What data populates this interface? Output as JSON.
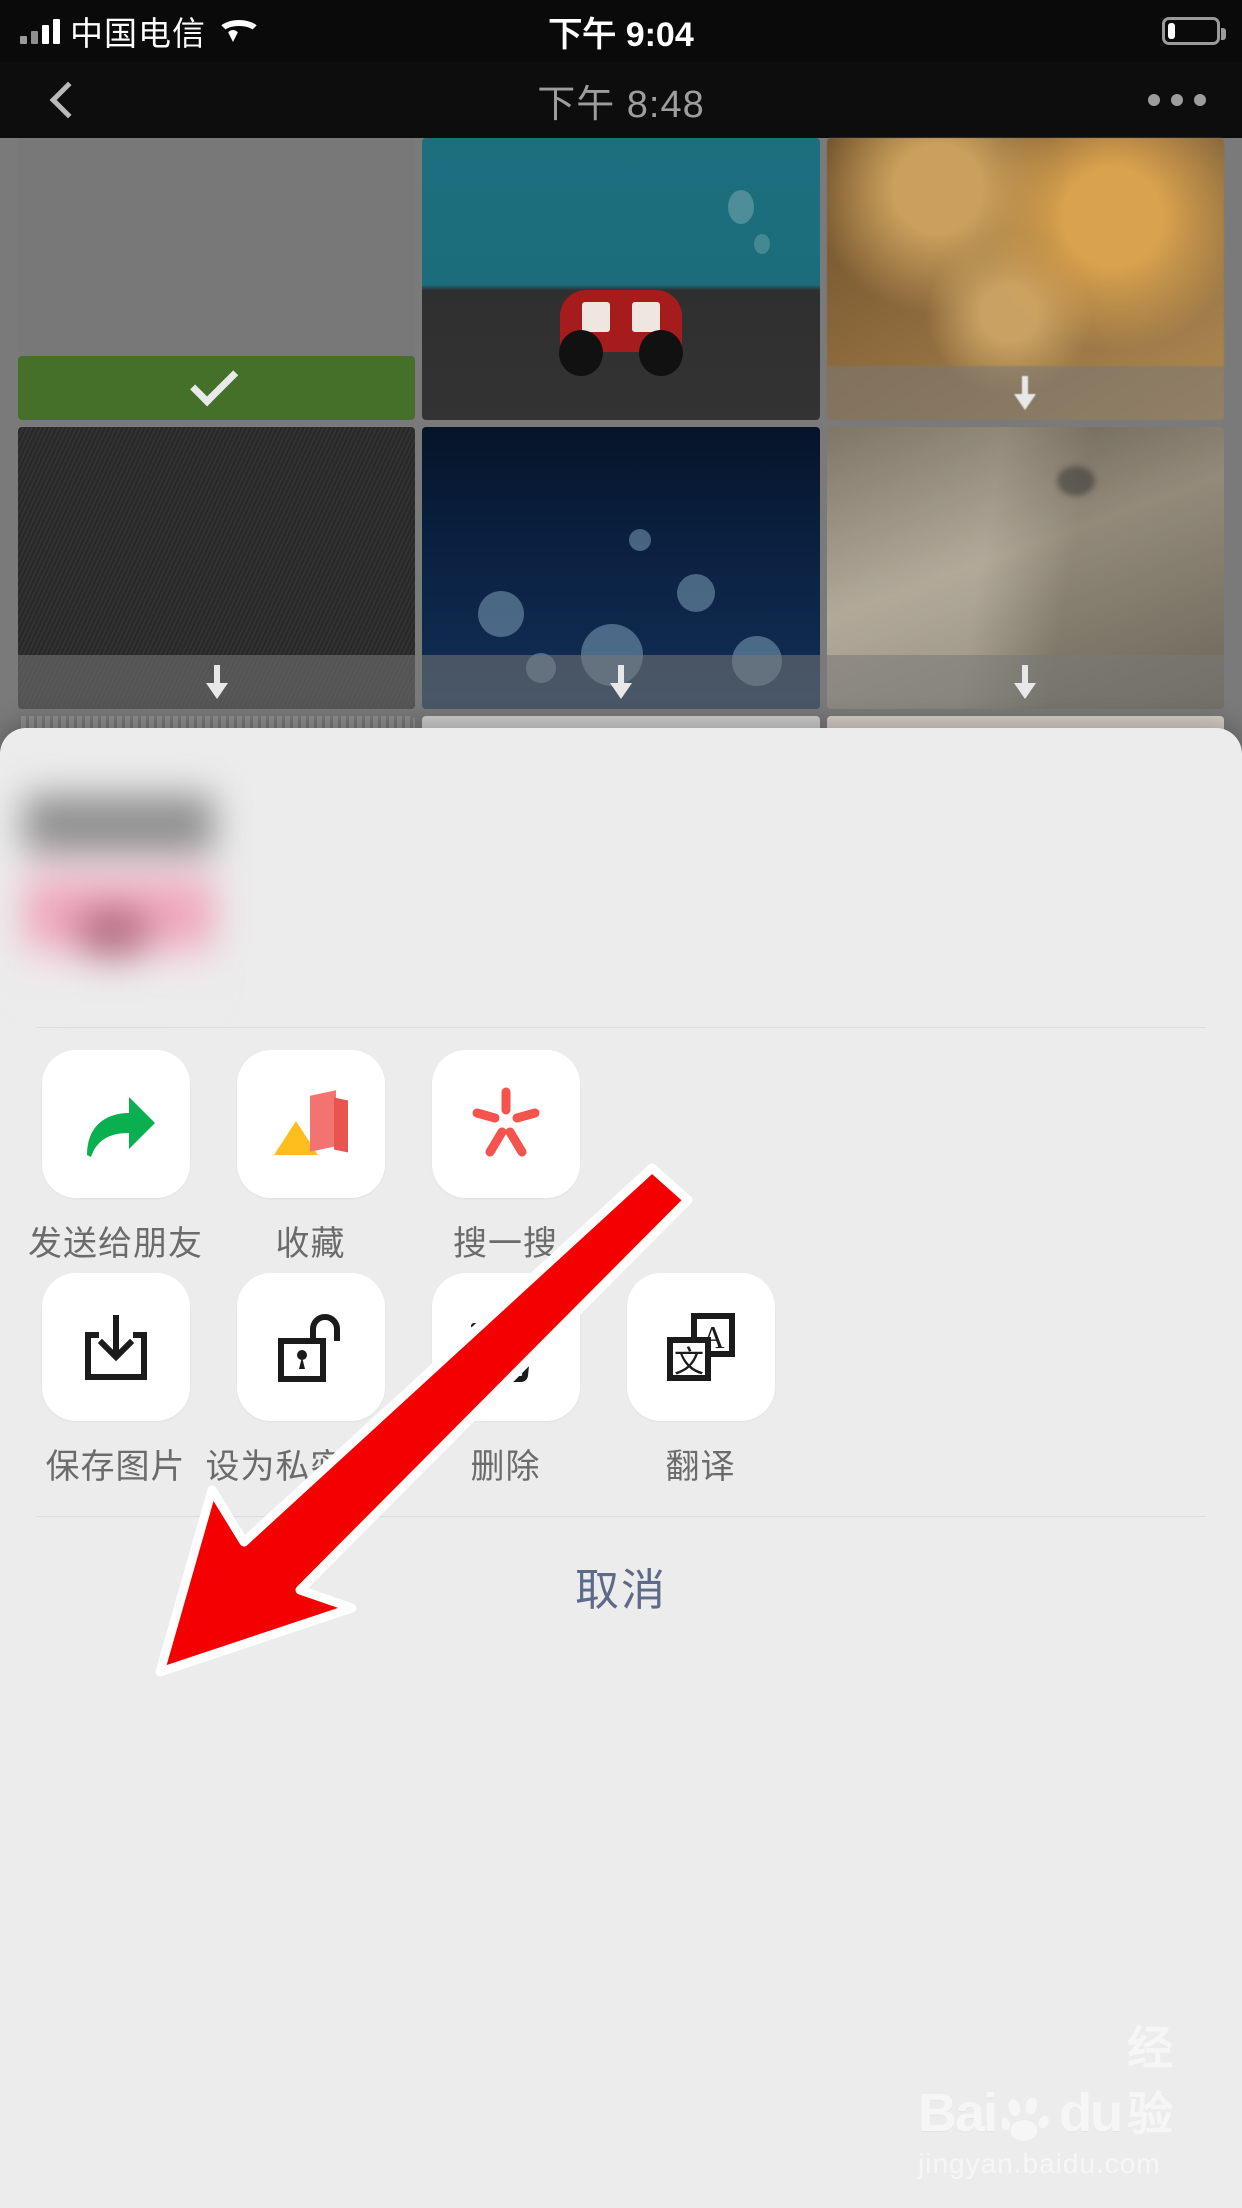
{
  "status_bar": {
    "carrier": "中国电信",
    "time": "下午 9:04",
    "signal_icon": "signal-bars-icon",
    "wifi_icon": "wifi-icon",
    "battery_icon": "battery-icon",
    "battery_level_pct": 22
  },
  "nav_bar": {
    "back_icon": "chevron-left-icon",
    "title": "下午 8:48",
    "more_icon": "more-horizontal-icon"
  },
  "grid": {
    "tiles": [
      {
        "id": "tile-1",
        "art": "t-gray",
        "selected": true,
        "download_badge": false,
        "check_icon": "checkmark-icon"
      },
      {
        "id": "tile-2",
        "art": "t-car",
        "selected": false,
        "download_badge": false
      },
      {
        "id": "tile-3",
        "art": "t-bokeh",
        "selected": false,
        "download_badge": true,
        "download_icon": "download-arrow-icon"
      },
      {
        "id": "tile-4",
        "art": "t-dark",
        "selected": false,
        "download_badge": true,
        "download_icon": "download-arrow-icon"
      },
      {
        "id": "tile-5",
        "art": "t-night",
        "selected": false,
        "download_badge": true,
        "download_icon": "download-arrow-icon"
      },
      {
        "id": "tile-6",
        "art": "t-glass",
        "selected": false,
        "download_badge": true,
        "download_icon": "download-arrow-icon"
      }
    ],
    "partial_row": [
      {
        "id": "tile-7",
        "art": "r3a"
      },
      {
        "id": "tile-8",
        "art": "r3b"
      },
      {
        "id": "tile-9",
        "art": "r3c"
      }
    ]
  },
  "action_sheet": {
    "preview_thumbnail": "blurred-photo-thumbnail",
    "rows": [
      {
        "items": [
          {
            "label": "发送给朋友",
            "icon": "forward-arrow-icon"
          },
          {
            "label": "收藏",
            "icon": "favorites-icon"
          },
          {
            "label": "搜一搜",
            "icon": "search-sparkle-icon"
          }
        ]
      },
      {
        "items": [
          {
            "label": "保存图片",
            "icon": "save-download-icon"
          },
          {
            "label": "设为私密照片",
            "icon": "unlock-padlock-icon"
          },
          {
            "label": "删除",
            "icon": "trash-icon"
          },
          {
            "label": "翻译",
            "icon": "translate-icon"
          }
        ]
      }
    ],
    "cancel_label": "取消"
  },
  "annotation": {
    "arrow_icon": "red-pointer-arrow",
    "arrow_color": "#f40000",
    "arrow_outline": "#ffffff"
  },
  "watermark": {
    "brand_latin": "Bai",
    "brand_latin2": "du",
    "brand_cn": "经验",
    "url": "jingyan.baidu.com",
    "paw_icon": "baidu-paw-icon"
  },
  "colors": {
    "sheet_bg": "#ececec",
    "tile_bg": "#7a7a7a",
    "select_green": "#44702a",
    "forward_green": "#0ab04f",
    "search_red": "#f4534e",
    "cancel_blue": "#5c6b8a",
    "label_gray": "#6b6b6b"
  }
}
